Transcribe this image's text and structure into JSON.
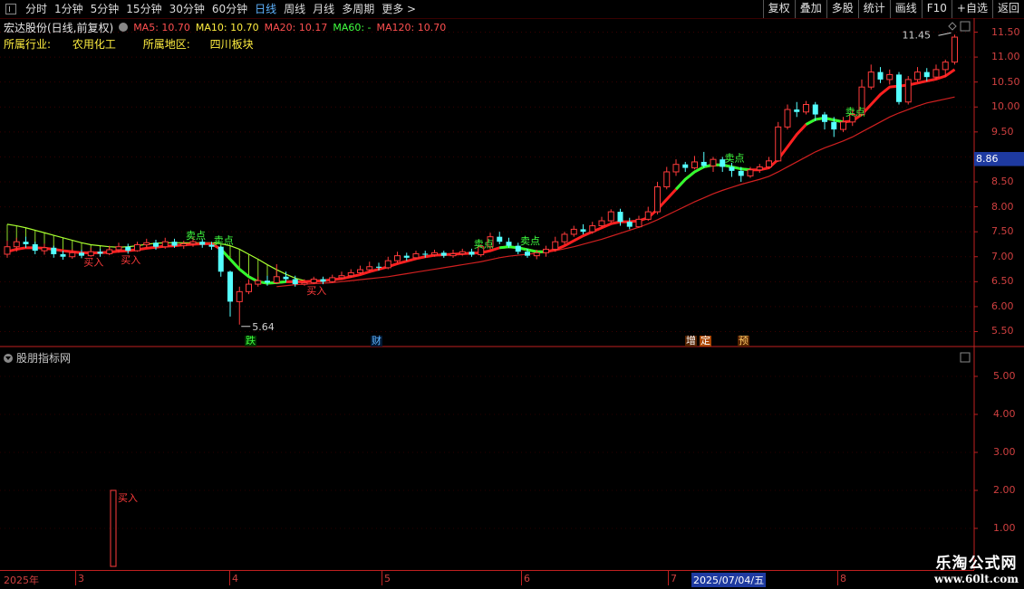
{
  "toolbar": {
    "periods": [
      "分时",
      "1分钟",
      "5分钟",
      "15分钟",
      "30分钟",
      "60分钟",
      "日线",
      "周线",
      "月线",
      "多周期",
      "更多 >"
    ],
    "active_period": "日线",
    "right_buttons": [
      "复权",
      "叠加",
      "多股",
      "统计",
      "画线",
      "F10",
      "+自选",
      "返回"
    ]
  },
  "header": {
    "stock_title": "宏达股份(日线,前复权)",
    "ma5": "MA5: 10.70",
    "ma10": "MA10: 10.70",
    "ma20": "MA20: 10.17",
    "ma60": "MA60: -",
    "ma120": "MA120: 10.70"
  },
  "info": {
    "industry_label": "所属行业:",
    "industry_value": "农用化工",
    "region_label": "所属地区:",
    "region_value": "四川板块"
  },
  "colors": {
    "up": "#ff3b3b",
    "down": "#54ffff",
    "ma_line": "#ff2020",
    "ma_slow": "#d02020",
    "band": "#a8ff30",
    "axis": "#c02020",
    "signal_buy": "#ff3b3b",
    "signal_sell": "#40ff40"
  },
  "main_axis": {
    "labels": [
      "11.50",
      "11.00",
      "10.50",
      "10.00",
      "9.50",
      "9.00",
      "8.50",
      "8.00",
      "7.50",
      "7.00",
      "6.50",
      "6.00",
      "5.50"
    ],
    "min": 5.4,
    "max": 11.6
  },
  "current_price": "8.86",
  "annotations": {
    "high": "11.45",
    "low": "5.64",
    "buy": "买入",
    "sell": "卖点"
  },
  "event_markers": [
    {
      "text": "跌",
      "color": "#40ff40",
      "bg": "#003300"
    },
    {
      "text": "财",
      "color": "#5fb4ff",
      "bg": "#001833"
    },
    {
      "text": "增",
      "color": "#ffffff",
      "bg": "#552200"
    },
    {
      "text": "定",
      "color": "#ffffff",
      "bg": "#aa4400"
    },
    {
      "text": "预",
      "color": "#ffcc66",
      "bg": "#552200"
    }
  ],
  "panel2": {
    "title": "股朋指标网",
    "axis_labels": [
      "5.00",
      "4.00",
      "3.00",
      "2.00",
      "1.00"
    ],
    "signal_label": "买入"
  },
  "date_axis": {
    "labels": [
      "2025年",
      "3",
      "4",
      "5",
      "6",
      "7",
      "2025/07/04/五",
      "8"
    ]
  },
  "watermark": {
    "line1": "乐淘公式网",
    "line2": "www.60lt.com"
  },
  "chart_data": {
    "type": "candlestick",
    "ohlc": [
      [
        7.05,
        7.2,
        7.32,
        6.98
      ],
      [
        7.2,
        7.3,
        7.38,
        7.1
      ],
      [
        7.3,
        7.25,
        7.4,
        7.18
      ],
      [
        7.25,
        7.12,
        7.3,
        7.05
      ],
      [
        7.12,
        7.18,
        7.26,
        7.04
      ],
      [
        7.18,
        7.05,
        7.22,
        6.98
      ],
      [
        7.05,
        7.0,
        7.12,
        6.94
      ],
      [
        7.0,
        7.08,
        7.15,
        6.96
      ],
      [
        7.08,
        7.02,
        7.14,
        6.97
      ],
      [
        7.02,
        7.1,
        7.18,
        7.0
      ],
      [
        7.1,
        7.06,
        7.16,
        7.0
      ],
      [
        7.06,
        7.14,
        7.22,
        7.03
      ],
      [
        7.14,
        7.2,
        7.28,
        7.08
      ],
      [
        7.2,
        7.12,
        7.26,
        7.06
      ],
      [
        7.12,
        7.24,
        7.3,
        7.1
      ],
      [
        7.24,
        7.28,
        7.36,
        7.18
      ],
      [
        7.28,
        7.2,
        7.34,
        7.14
      ],
      [
        7.2,
        7.3,
        7.38,
        7.16
      ],
      [
        7.3,
        7.22,
        7.36,
        7.18
      ],
      [
        7.22,
        7.26,
        7.32,
        7.16
      ],
      [
        7.26,
        7.3,
        7.4,
        7.2
      ],
      [
        7.3,
        7.24,
        7.36,
        7.18
      ],
      [
        7.24,
        7.2,
        7.3,
        7.14
      ],
      [
        7.2,
        6.7,
        7.22,
        6.6
      ],
      [
        6.7,
        6.1,
        6.72,
        5.8
      ],
      [
        6.1,
        6.3,
        6.4,
        5.64
      ],
      [
        6.3,
        6.45,
        6.55,
        6.25
      ],
      [
        6.45,
        6.52,
        6.6,
        6.4
      ],
      [
        6.52,
        6.48,
        6.62,
        6.42
      ],
      [
        6.48,
        6.6,
        6.85,
        6.45
      ],
      [
        6.6,
        6.55,
        6.7,
        6.5
      ],
      [
        6.55,
        6.45,
        6.62,
        6.4
      ],
      [
        6.45,
        6.48,
        6.55,
        6.42
      ],
      [
        6.48,
        6.55,
        6.6,
        6.45
      ],
      [
        6.55,
        6.5,
        6.6,
        6.45
      ],
      [
        6.5,
        6.58,
        6.64,
        6.48
      ],
      [
        6.58,
        6.62,
        6.7,
        6.55
      ],
      [
        6.62,
        6.68,
        6.75,
        6.58
      ],
      [
        6.68,
        6.74,
        6.82,
        6.65
      ],
      [
        6.74,
        6.8,
        6.9,
        6.7
      ],
      [
        6.8,
        6.78,
        6.88,
        6.72
      ],
      [
        6.78,
        6.92,
        7.0,
        6.75
      ],
      [
        6.92,
        7.02,
        7.1,
        6.88
      ],
      [
        7.02,
        6.98,
        7.08,
        6.92
      ],
      [
        6.98,
        7.06,
        7.12,
        6.95
      ],
      [
        7.06,
        7.04,
        7.12,
        6.98
      ],
      [
        7.04,
        7.08,
        7.14,
        7.0
      ],
      [
        7.08,
        7.02,
        7.12,
        6.98
      ],
      [
        7.02,
        7.06,
        7.14,
        6.98
      ],
      [
        7.06,
        7.1,
        7.16,
        7.02
      ],
      [
        7.1,
        7.04,
        7.16,
        7.0
      ],
      [
        7.04,
        7.2,
        7.25,
        7.0
      ],
      [
        7.2,
        7.4,
        7.48,
        7.15
      ],
      [
        7.4,
        7.3,
        7.5,
        7.25
      ],
      [
        7.3,
        7.22,
        7.38,
        7.18
      ],
      [
        7.22,
        7.1,
        7.28,
        7.05
      ],
      [
        7.1,
        7.02,
        7.16,
        6.98
      ],
      [
        7.02,
        7.08,
        7.14,
        6.95
      ],
      [
        7.08,
        7.15,
        7.22,
        7.0
      ],
      [
        7.15,
        7.3,
        7.4,
        7.1
      ],
      [
        7.3,
        7.45,
        7.5,
        7.25
      ],
      [
        7.45,
        7.55,
        7.62,
        7.4
      ],
      [
        7.55,
        7.5,
        7.65,
        7.45
      ],
      [
        7.5,
        7.62,
        7.7,
        7.46
      ],
      [
        7.62,
        7.72,
        7.8,
        7.58
      ],
      [
        7.72,
        7.9,
        7.95,
        7.68
      ],
      [
        7.9,
        7.7,
        7.96,
        7.62
      ],
      [
        7.7,
        7.6,
        7.78,
        7.55
      ],
      [
        7.6,
        7.75,
        7.82,
        7.58
      ],
      [
        7.75,
        7.9,
        8.0,
        7.72
      ],
      [
        7.9,
        8.4,
        8.5,
        7.85
      ],
      [
        8.4,
        8.7,
        8.8,
        8.35
      ],
      [
        8.7,
        8.85,
        8.95,
        8.62
      ],
      [
        8.85,
        8.78,
        8.9,
        8.7
      ],
      [
        8.78,
        8.9,
        9.02,
        8.75
      ],
      [
        8.9,
        8.82,
        9.1,
        8.78
      ],
      [
        8.82,
        8.95,
        9.0,
        8.7
      ],
      [
        8.95,
        8.8,
        9.0,
        8.7
      ],
      [
        8.8,
        8.72,
        8.88,
        8.6
      ],
      [
        8.72,
        8.62,
        8.8,
        8.5
      ],
      [
        8.62,
        8.74,
        8.8,
        8.58
      ],
      [
        8.74,
        8.8,
        8.86,
        8.68
      ],
      [
        8.8,
        8.92,
        9.0,
        8.76
      ],
      [
        8.92,
        9.6,
        9.7,
        8.9
      ],
      [
        9.6,
        9.95,
        10.05,
        9.55
      ],
      [
        9.95,
        9.9,
        10.1,
        9.8
      ],
      [
        9.9,
        10.05,
        10.12,
        9.85
      ],
      [
        10.05,
        9.85,
        10.1,
        9.72
      ],
      [
        9.85,
        9.7,
        9.9,
        9.55
      ],
      [
        9.7,
        9.55,
        9.8,
        9.4
      ],
      [
        9.55,
        9.7,
        9.8,
        9.5
      ],
      [
        9.7,
        9.85,
        9.95,
        9.62
      ],
      [
        9.85,
        10.4,
        10.55,
        9.82
      ],
      [
        10.4,
        10.7,
        10.85,
        10.35
      ],
      [
        10.7,
        10.55,
        10.8,
        10.48
      ],
      [
        10.55,
        10.65,
        10.75,
        10.45
      ],
      [
        10.65,
        10.1,
        10.7,
        10.05
      ],
      [
        10.1,
        10.55,
        10.62,
        10.05
      ],
      [
        10.55,
        10.7,
        10.8,
        10.5
      ],
      [
        10.7,
        10.6,
        10.78,
        10.52
      ],
      [
        10.6,
        10.75,
        10.85,
        10.55
      ],
      [
        10.75,
        10.9,
        10.95,
        10.6
      ],
      [
        10.9,
        11.4,
        11.45,
        10.85
      ]
    ],
    "ma_fast": [
      7.1,
      7.15,
      7.18,
      7.18,
      7.17,
      7.15,
      7.12,
      7.1,
      7.08,
      7.08,
      7.08,
      7.09,
      7.11,
      7.12,
      7.14,
      7.17,
      7.19,
      7.21,
      7.22,
      7.24,
      7.25,
      7.26,
      7.26,
      7.15,
      6.95,
      6.75,
      6.6,
      6.5,
      6.47,
      6.48,
      6.5,
      6.5,
      6.5,
      6.51,
      6.52,
      6.54,
      6.56,
      6.6,
      6.64,
      6.7,
      6.75,
      6.8,
      6.86,
      6.91,
      6.96,
      7.0,
      7.03,
      7.04,
      7.05,
      7.06,
      7.07,
      7.08,
      7.12,
      7.18,
      7.2,
      7.18,
      7.14,
      7.1,
      7.1,
      7.14,
      7.22,
      7.32,
      7.42,
      7.5,
      7.58,
      7.66,
      7.7,
      7.7,
      7.72,
      7.78,
      7.95,
      8.15,
      8.35,
      8.55,
      8.7,
      8.8,
      8.84,
      8.84,
      8.8,
      8.76,
      8.74,
      8.74,
      8.78,
      8.95,
      9.2,
      9.45,
      9.65,
      9.75,
      9.78,
      9.74,
      9.7,
      9.72,
      9.85,
      10.05,
      10.25,
      10.4,
      10.42,
      10.44,
      10.48,
      10.52,
      10.56,
      10.62,
      10.75
    ],
    "ma_slow": [
      null,
      null,
      null,
      null,
      null,
      null,
      null,
      null,
      null,
      null,
      null,
      null,
      null,
      null,
      null,
      null,
      null,
      null,
      null,
      null,
      null,
      null,
      null,
      null,
      null,
      null,
      null,
      null,
      null,
      6.4,
      6.42,
      6.44,
      6.45,
      6.46,
      6.47,
      6.48,
      6.5,
      6.52,
      6.54,
      6.56,
      6.58,
      6.6,
      6.63,
      6.66,
      6.69,
      6.72,
      6.75,
      6.78,
      6.81,
      6.84,
      6.87,
      6.9,
      6.94,
      6.98,
      7.01,
      7.03,
      7.05,
      7.07,
      7.09,
      7.12,
      7.16,
      7.2,
      7.25,
      7.3,
      7.35,
      7.41,
      7.47,
      7.53,
      7.59,
      7.66,
      7.74,
      7.83,
      7.92,
      8.01,
      8.1,
      8.18,
      8.26,
      8.33,
      8.39,
      8.45,
      8.5,
      8.55,
      8.61,
      8.7,
      8.8,
      8.9,
      9.0,
      9.1,
      9.18,
      9.25,
      9.32,
      9.4,
      9.5,
      9.6,
      9.7,
      9.8,
      9.88,
      9.95,
      10.02,
      10.08,
      10.12,
      10.16,
      10.2
    ],
    "band_top": [
      7.65,
      7.62,
      7.58,
      7.53,
      7.48,
      7.43,
      7.38,
      7.33,
      7.28,
      7.24,
      7.22,
      7.2,
      7.19,
      7.2,
      7.22,
      7.25,
      7.27,
      7.28,
      7.28,
      7.28,
      7.28,
      7.28,
      7.28,
      7.26,
      7.22,
      7.15,
      7.05,
      6.95,
      6.84,
      6.74,
      6.65,
      6.57,
      6.52,
      null
    ],
    "buy_signal_index": 37,
    "indicator_spike": {
      "x_index": 36,
      "value": 2.0,
      "range": [
        0,
        5.5
      ]
    }
  }
}
